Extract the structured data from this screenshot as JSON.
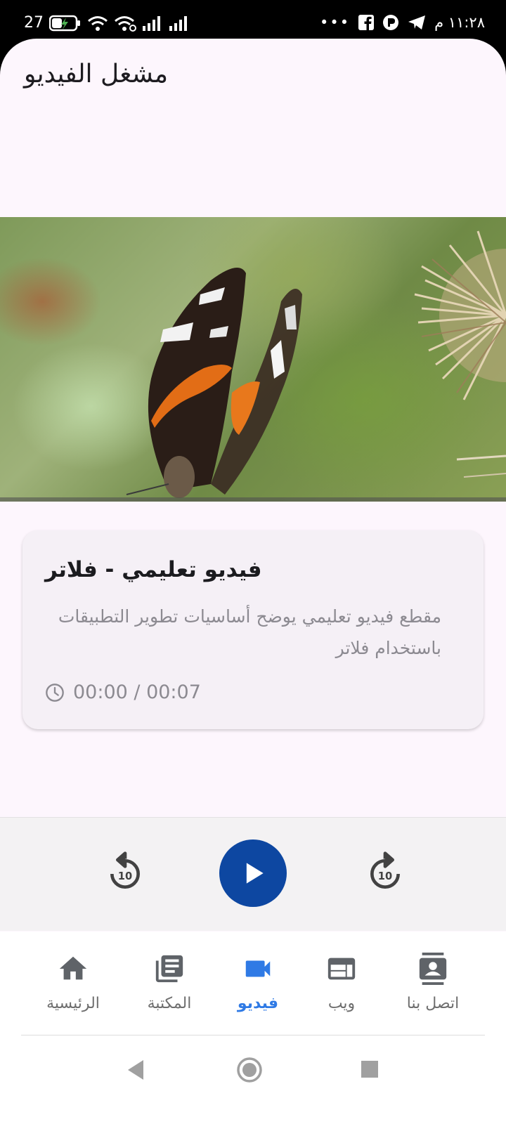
{
  "status_bar": {
    "time": "١١:٢٨ م",
    "battery": "27",
    "icons": [
      "battery-charging-icon",
      "wifi-icon",
      "wifi-link-icon",
      "signal-icon",
      "signal-icon",
      "more-dots-icon",
      "facebook-icon",
      "app-icon",
      "telegram-icon"
    ]
  },
  "app_bar": {
    "title": "مشغل الفيديو"
  },
  "video": {
    "subject": "butterfly-on-thistle",
    "progress": 0.0
  },
  "info_card": {
    "title": "فيديو تعليمي - فلاتر",
    "description": "مقطع فيديو تعليمي يوضح أساسيات تطوير التطبيقات باستخدام فلاتر",
    "time_text": "00:00 / 00:07",
    "time_icon": "clock-icon"
  },
  "controls": {
    "rewind_label": "10",
    "forward_label": "10",
    "play_color": "#0d47a1"
  },
  "bottom_nav": {
    "items": [
      {
        "label": "الرئيسية",
        "icon": "home-icon"
      },
      {
        "label": "المكتبة",
        "icon": "library-icon"
      },
      {
        "label": "فيديو",
        "icon": "videocam-icon",
        "active": true
      },
      {
        "label": "ويب",
        "icon": "web-icon"
      },
      {
        "label": "اتصل بنا",
        "icon": "contact-icon"
      }
    ],
    "active_color": "#2f7ae5"
  }
}
